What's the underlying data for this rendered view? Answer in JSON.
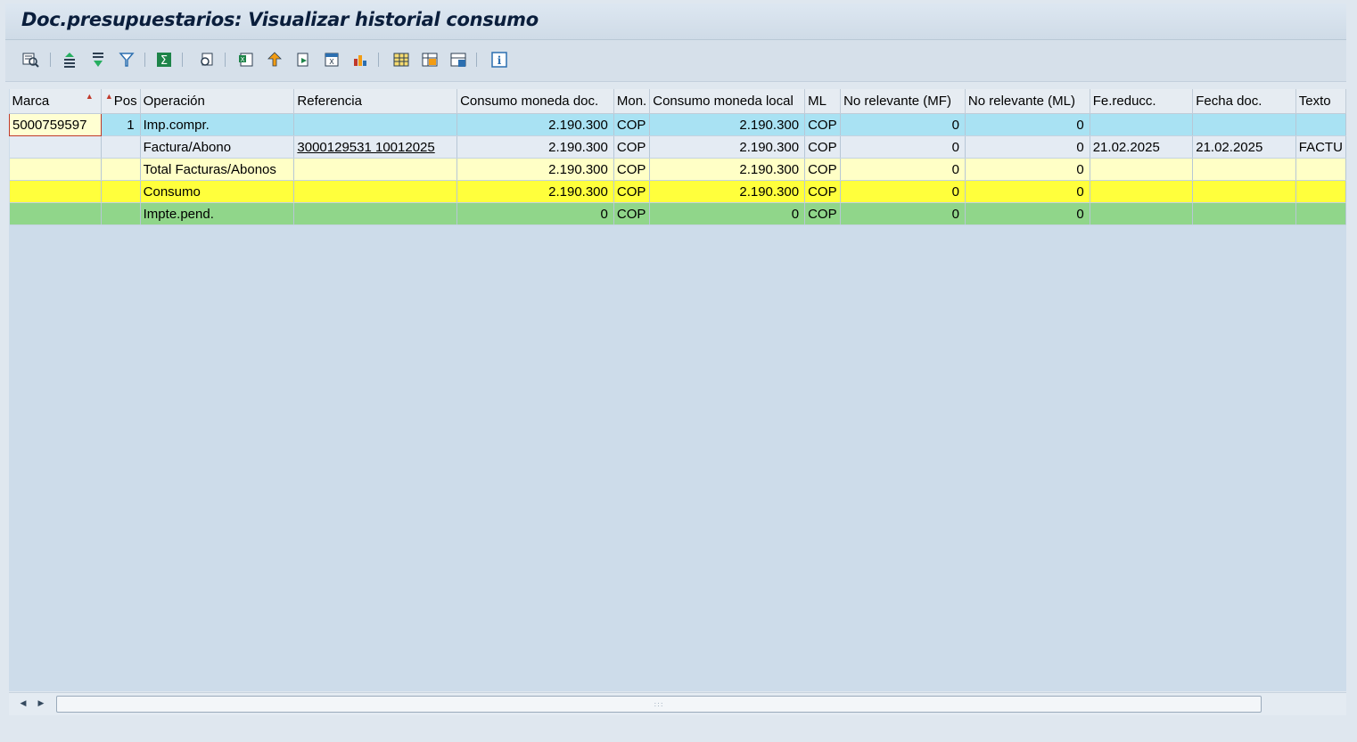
{
  "title": "Doc.presupuestarios: Visualizar historial consumo",
  "toolbar": {
    "icons": [
      "details-icon",
      "sort-ascending-icon",
      "sort-descending-icon",
      "filter-icon",
      "sum-icon",
      "print-preview-icon",
      "export-spreadsheet-icon",
      "word-processing-icon",
      "local-file-icon",
      "abc-analysis-icon",
      "graphic-icon",
      "change-layout-icon",
      "select-layout-icon",
      "save-layout-icon",
      "info-icon"
    ]
  },
  "table": {
    "columns": [
      "Marca",
      "Pos",
      "Operación",
      "Referencia",
      "Consumo moneda doc.",
      "Mon.",
      "Consumo moneda local",
      "ML",
      "No relevante (MF)",
      "No relevante (ML)",
      "Fe.reducc.",
      "Fecha doc.",
      "Texto"
    ],
    "rows": [
      {
        "type": "imp",
        "marca": "5000759597",
        "pos": "1",
        "operacion": "Imp.compr.",
        "referencia": "",
        "consumo_doc": "2.190.300",
        "mon": "COP",
        "consumo_local": "2.190.300",
        "ml": "COP",
        "no_rel_mf": "0",
        "no_rel_ml": "0",
        "fe_reducc": "",
        "fecha_doc": "",
        "texto": ""
      },
      {
        "type": "fac",
        "marca": "",
        "pos": "",
        "operacion": "Factura/Abono",
        "referencia": "3000129531 10012025",
        "consumo_doc": "2.190.300",
        "mon": "COP",
        "consumo_local": "2.190.300",
        "ml": "COP",
        "no_rel_mf": "0",
        "no_rel_ml": "0",
        "fe_reducc": "21.02.2025",
        "fecha_doc": "21.02.2025",
        "texto": "FACTU"
      },
      {
        "type": "tot",
        "marca": "",
        "pos": "",
        "operacion": "Total Facturas/Abonos",
        "referencia": "",
        "consumo_doc": "2.190.300",
        "mon": "COP",
        "consumo_local": "2.190.300",
        "ml": "COP",
        "no_rel_mf": "0",
        "no_rel_ml": "0",
        "fe_reducc": "",
        "fecha_doc": "",
        "texto": ""
      },
      {
        "type": "con",
        "marca": "",
        "pos": "",
        "operacion": "Consumo",
        "referencia": "",
        "consumo_doc": "2.190.300",
        "mon": "COP",
        "consumo_local": "2.190.300",
        "ml": "COP",
        "no_rel_mf": "0",
        "no_rel_ml": "0",
        "fe_reducc": "",
        "fecha_doc": "",
        "texto": ""
      },
      {
        "type": "pen",
        "marca": "",
        "pos": "",
        "operacion": "Impte.pend.",
        "referencia": "",
        "consumo_doc": "0",
        "mon": "COP",
        "consumo_local": "0",
        "ml": "COP",
        "no_rel_mf": "0",
        "no_rel_ml": "0",
        "fe_reducc": "",
        "fecha_doc": "",
        "texto": ""
      }
    ]
  },
  "colors": {
    "row_imp": "#a9e2f3",
    "row_factura": "#e4ebf3",
    "row_total": "#ffffc6",
    "row_consumo": "#ffff3c",
    "row_pendiente": "#90d68a",
    "grid_background": "#cddcea"
  }
}
